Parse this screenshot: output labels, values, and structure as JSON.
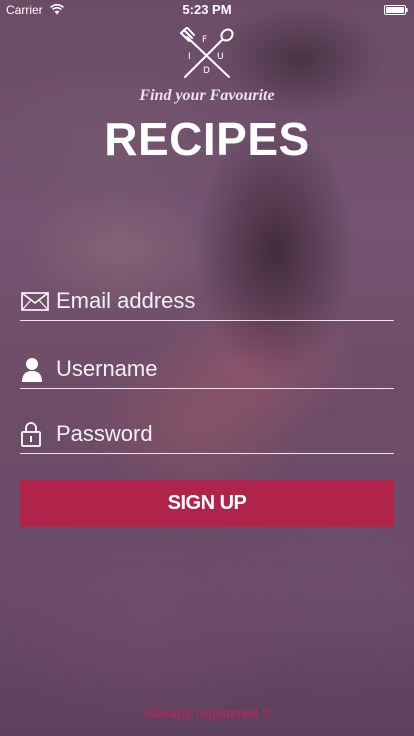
{
  "status_bar": {
    "carrier": "Carrier",
    "time": "5:23 PM",
    "wifi_icon": "wifi-icon",
    "battery_icon": "battery-icon"
  },
  "logo": {
    "icon": "fork-spoon-cross-icon",
    "letters": [
      "F",
      "I",
      "U",
      "D"
    ]
  },
  "header": {
    "tagline": "Find your Favourite",
    "title": "RECIPES"
  },
  "form": {
    "email": {
      "placeholder": "Email address",
      "value": "",
      "icon": "envelope-icon"
    },
    "username": {
      "placeholder": "Username",
      "value": "",
      "icon": "user-icon"
    },
    "password": {
      "placeholder": "Password",
      "value": "",
      "icon": "lock-icon"
    },
    "submit_label": "SIGN UP"
  },
  "footer": {
    "login_link": "Already registered ?"
  },
  "colors": {
    "accent": "#b0244c",
    "link": "#c02355",
    "text": "#ffffff"
  }
}
